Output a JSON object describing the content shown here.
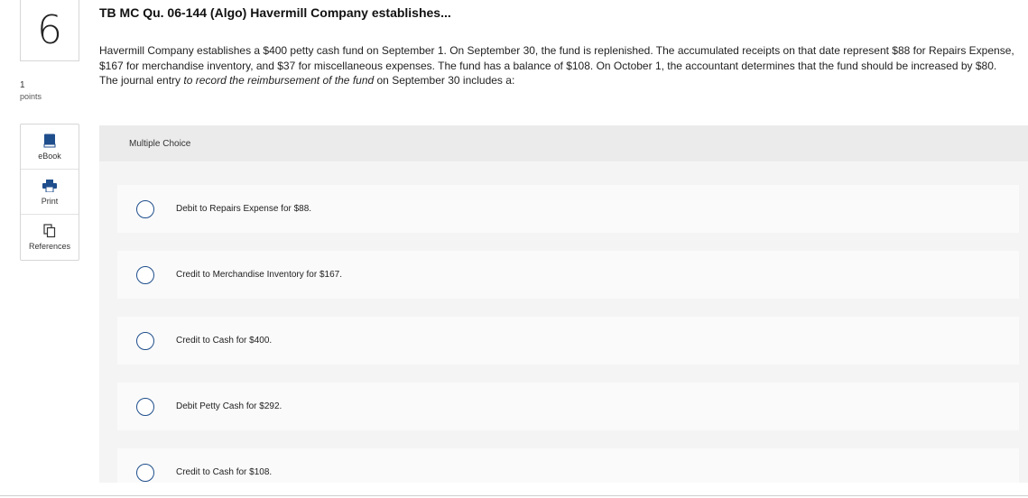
{
  "question": {
    "number": "6",
    "points_value": "1",
    "points_label": "points",
    "title": "TB MC Qu. 06-144 (Algo) Havermill Company establishes...",
    "body_before_em": "Havermill Company establishes a $400 petty cash fund on September 1. On September 30, the fund is replenished. The accumulated receipts on that date represent $88 for Repairs Expense, $167 for merchandise inventory, and $37 for miscellaneous expenses. The fund has a balance of $108. On October 1, the accountant determines that the fund should be increased by $80. The journal entry ",
    "body_em": "to record the reimbursement of the fund",
    "body_after_em": " on September 30 includes a:"
  },
  "tools": [
    {
      "label": "eBook",
      "icon": "book-icon",
      "color": "#1f4e8c"
    },
    {
      "label": "Print",
      "icon": "printer-icon",
      "color": "#1f4e8c"
    },
    {
      "label": "References",
      "icon": "copy-icon",
      "color": "#333333"
    }
  ],
  "multiple_choice": {
    "header": "Multiple Choice",
    "options": [
      {
        "label": "Debit to Repairs Expense for $88.",
        "selected": false
      },
      {
        "label": "Credit to Merchandise Inventory for $167.",
        "selected": false
      },
      {
        "label": "Credit to Cash for $400.",
        "selected": false
      },
      {
        "label": "Debit Petty Cash for $292.",
        "selected": false
      },
      {
        "label": "Credit to Cash for $108.",
        "selected": false
      }
    ]
  },
  "colors": {
    "accent": "#1f4e8c",
    "panel_bg": "#f4f4f4",
    "header_bg": "#ebebeb",
    "option_bg": "#fafafa"
  }
}
